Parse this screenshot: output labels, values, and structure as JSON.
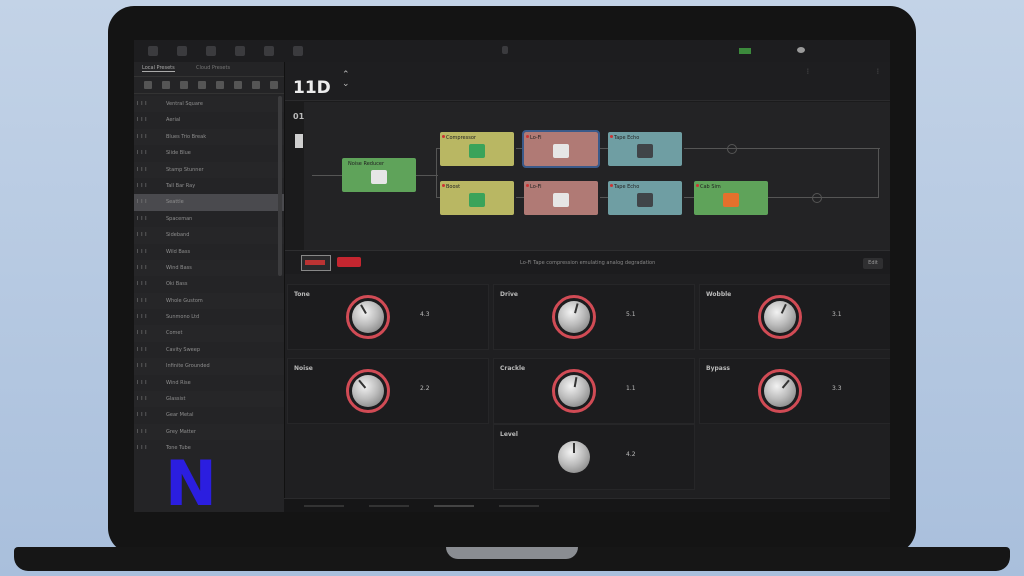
{
  "brand_colors": {
    "accent_red": "#d14b55",
    "logo": "#2b1ee0"
  },
  "logo": {
    "letter": "N"
  },
  "header": {
    "preset_number": "11D",
    "updown_icon": "chevron-up-down-icon",
    "slot_label": "01"
  },
  "sidebar": {
    "tabs": [
      "Local Presets",
      "Cloud Presets"
    ],
    "presets": [
      {
        "num": "I I I",
        "name": "Ventral Square"
      },
      {
        "num": "I I I",
        "name": "Aerial"
      },
      {
        "num": "I I I",
        "name": "Blues Trio Break"
      },
      {
        "num": "I I I",
        "name": "Slide Blue"
      },
      {
        "num": "I I I",
        "name": "Stamp Stunner"
      },
      {
        "num": "I I I",
        "name": "Tall Bar Ray"
      },
      {
        "num": "I I I",
        "name": "Seattle"
      },
      {
        "num": "I I I",
        "name": "Spaceman"
      },
      {
        "num": "I I I",
        "name": "Sideband"
      },
      {
        "num": "I I I",
        "name": "Wild Bass"
      },
      {
        "num": "I I I",
        "name": "Wind Bass"
      },
      {
        "num": "I I I",
        "name": "Oki Bass"
      },
      {
        "num": "I I I",
        "name": "Whole Gustom"
      },
      {
        "num": "I I I",
        "name": "Sunmono Ltd"
      },
      {
        "num": "I I I",
        "name": "Comet"
      },
      {
        "num": "I I I",
        "name": "Cavity Sweep"
      },
      {
        "num": "I I I",
        "name": "Infinite Grounded"
      },
      {
        "num": "I I I",
        "name": "Wind Rise"
      },
      {
        "num": "I I I",
        "name": "Glassist"
      },
      {
        "num": "I I I",
        "name": "Gear Metal"
      },
      {
        "num": "I I I",
        "name": "Grey Matter"
      },
      {
        "num": "I I I",
        "name": "Tone Tube"
      }
    ],
    "selected_index": 6
  },
  "chain": {
    "blocks": [
      {
        "id": "input",
        "name": "Noise Reducer",
        "color": "#5fa35a",
        "icon": "#e6e6e6",
        "dot": false
      },
      {
        "id": "b1",
        "name": "Compressor",
        "color": "#b9b763",
        "icon": "#3aa35a",
        "dot": true
      },
      {
        "id": "b2",
        "name": "Lo-Fi",
        "color": "#b07a75",
        "icon": "#e6e6e6",
        "dot": true,
        "selected": true
      },
      {
        "id": "b3",
        "name": "Tape Echo",
        "color": "#6f9ea3",
        "icon": "#404448",
        "dot": true
      },
      {
        "id": "b4",
        "name": "Boost",
        "color": "#b9b763",
        "icon": "#3aa35a",
        "dot": true
      },
      {
        "id": "b5",
        "name": "Lo-Fi",
        "color": "#b07a75",
        "icon": "#e6e6e6",
        "dot": true
      },
      {
        "id": "b6",
        "name": "Tape Echo",
        "color": "#6f9ea3",
        "icon": "#404448",
        "dot": true
      },
      {
        "id": "b7",
        "name": "Cab Sim",
        "color": "#5fa35a",
        "icon": "#e4702c",
        "dot": true
      }
    ]
  },
  "params": {
    "header_text": "Lo-Fi  Tape compression emulating analog degradation",
    "reset_label": "Edit",
    "knobs": [
      {
        "label": "Tone",
        "value": "4.3",
        "angle": -30
      },
      {
        "label": "Drive",
        "value": "5.1",
        "angle": 15
      },
      {
        "label": "Wobble",
        "value": "3.1",
        "angle": 25
      },
      {
        "label": "Noise",
        "value": "2.2",
        "angle": -40
      },
      {
        "label": "Crackle",
        "value": "1.1",
        "angle": 10
      },
      {
        "label": "Bypass",
        "value": "3.3",
        "angle": 40
      },
      {
        "label": "Level",
        "value": "4.2",
        "angle": 0
      }
    ]
  }
}
